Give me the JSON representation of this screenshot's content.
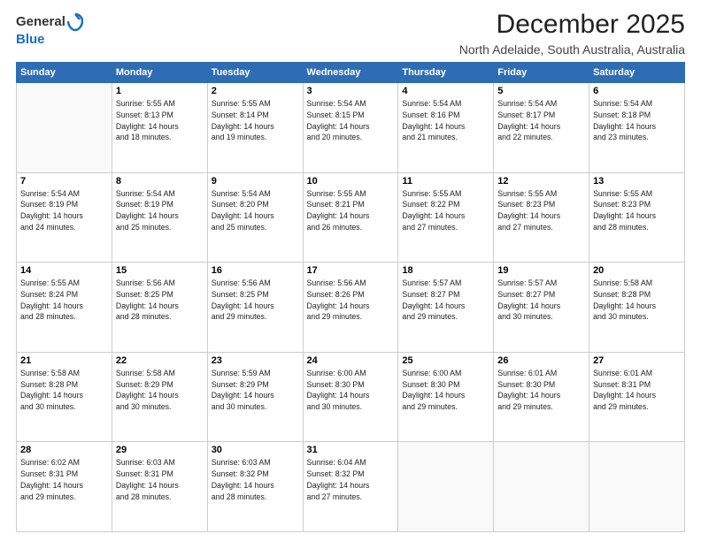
{
  "logo": {
    "general": "General",
    "blue": "Blue"
  },
  "header": {
    "title": "December 2025",
    "subtitle": "North Adelaide, South Australia, Australia"
  },
  "weekdays": [
    "Sunday",
    "Monday",
    "Tuesday",
    "Wednesday",
    "Thursday",
    "Friday",
    "Saturday"
  ],
  "weeks": [
    [
      {
        "day": "",
        "info": ""
      },
      {
        "day": "1",
        "info": "Sunrise: 5:55 AM\nSunset: 8:13 PM\nDaylight: 14 hours\nand 18 minutes."
      },
      {
        "day": "2",
        "info": "Sunrise: 5:55 AM\nSunset: 8:14 PM\nDaylight: 14 hours\nand 19 minutes."
      },
      {
        "day": "3",
        "info": "Sunrise: 5:54 AM\nSunset: 8:15 PM\nDaylight: 14 hours\nand 20 minutes."
      },
      {
        "day": "4",
        "info": "Sunrise: 5:54 AM\nSunset: 8:16 PM\nDaylight: 14 hours\nand 21 minutes."
      },
      {
        "day": "5",
        "info": "Sunrise: 5:54 AM\nSunset: 8:17 PM\nDaylight: 14 hours\nand 22 minutes."
      },
      {
        "day": "6",
        "info": "Sunrise: 5:54 AM\nSunset: 8:18 PM\nDaylight: 14 hours\nand 23 minutes."
      }
    ],
    [
      {
        "day": "7",
        "info": "Sunrise: 5:54 AM\nSunset: 8:19 PM\nDaylight: 14 hours\nand 24 minutes."
      },
      {
        "day": "8",
        "info": "Sunrise: 5:54 AM\nSunset: 8:19 PM\nDaylight: 14 hours\nand 25 minutes."
      },
      {
        "day": "9",
        "info": "Sunrise: 5:54 AM\nSunset: 8:20 PM\nDaylight: 14 hours\nand 25 minutes."
      },
      {
        "day": "10",
        "info": "Sunrise: 5:55 AM\nSunset: 8:21 PM\nDaylight: 14 hours\nand 26 minutes."
      },
      {
        "day": "11",
        "info": "Sunrise: 5:55 AM\nSunset: 8:22 PM\nDaylight: 14 hours\nand 27 minutes."
      },
      {
        "day": "12",
        "info": "Sunrise: 5:55 AM\nSunset: 8:23 PM\nDaylight: 14 hours\nand 27 minutes."
      },
      {
        "day": "13",
        "info": "Sunrise: 5:55 AM\nSunset: 8:23 PM\nDaylight: 14 hours\nand 28 minutes."
      }
    ],
    [
      {
        "day": "14",
        "info": "Sunrise: 5:55 AM\nSunset: 8:24 PM\nDaylight: 14 hours\nand 28 minutes."
      },
      {
        "day": "15",
        "info": "Sunrise: 5:56 AM\nSunset: 8:25 PM\nDaylight: 14 hours\nand 28 minutes."
      },
      {
        "day": "16",
        "info": "Sunrise: 5:56 AM\nSunset: 8:25 PM\nDaylight: 14 hours\nand 29 minutes."
      },
      {
        "day": "17",
        "info": "Sunrise: 5:56 AM\nSunset: 8:26 PM\nDaylight: 14 hours\nand 29 minutes."
      },
      {
        "day": "18",
        "info": "Sunrise: 5:57 AM\nSunset: 8:27 PM\nDaylight: 14 hours\nand 29 minutes."
      },
      {
        "day": "19",
        "info": "Sunrise: 5:57 AM\nSunset: 8:27 PM\nDaylight: 14 hours\nand 30 minutes."
      },
      {
        "day": "20",
        "info": "Sunrise: 5:58 AM\nSunset: 8:28 PM\nDaylight: 14 hours\nand 30 minutes."
      }
    ],
    [
      {
        "day": "21",
        "info": "Sunrise: 5:58 AM\nSunset: 8:28 PM\nDaylight: 14 hours\nand 30 minutes."
      },
      {
        "day": "22",
        "info": "Sunrise: 5:58 AM\nSunset: 8:29 PM\nDaylight: 14 hours\nand 30 minutes."
      },
      {
        "day": "23",
        "info": "Sunrise: 5:59 AM\nSunset: 8:29 PM\nDaylight: 14 hours\nand 30 minutes."
      },
      {
        "day": "24",
        "info": "Sunrise: 6:00 AM\nSunset: 8:30 PM\nDaylight: 14 hours\nand 30 minutes."
      },
      {
        "day": "25",
        "info": "Sunrise: 6:00 AM\nSunset: 8:30 PM\nDaylight: 14 hours\nand 29 minutes."
      },
      {
        "day": "26",
        "info": "Sunrise: 6:01 AM\nSunset: 8:30 PM\nDaylight: 14 hours\nand 29 minutes."
      },
      {
        "day": "27",
        "info": "Sunrise: 6:01 AM\nSunset: 8:31 PM\nDaylight: 14 hours\nand 29 minutes."
      }
    ],
    [
      {
        "day": "28",
        "info": "Sunrise: 6:02 AM\nSunset: 8:31 PM\nDaylight: 14 hours\nand 29 minutes."
      },
      {
        "day": "29",
        "info": "Sunrise: 6:03 AM\nSunset: 8:31 PM\nDaylight: 14 hours\nand 28 minutes."
      },
      {
        "day": "30",
        "info": "Sunrise: 6:03 AM\nSunset: 8:32 PM\nDaylight: 14 hours\nand 28 minutes."
      },
      {
        "day": "31",
        "info": "Sunrise: 6:04 AM\nSunset: 8:32 PM\nDaylight: 14 hours\nand 27 minutes."
      },
      {
        "day": "",
        "info": ""
      },
      {
        "day": "",
        "info": ""
      },
      {
        "day": "",
        "info": ""
      }
    ]
  ]
}
